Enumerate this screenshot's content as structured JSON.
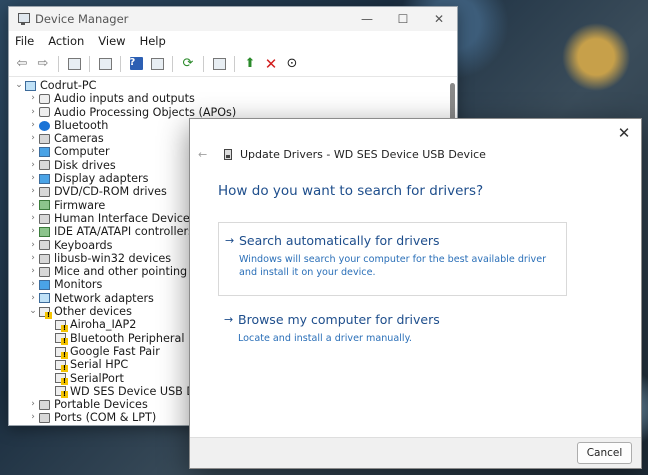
{
  "device_manager": {
    "title": "Device Manager",
    "window_controls": {
      "minimize": "—",
      "maximize": "☐",
      "close": "✕"
    },
    "menu": [
      "File",
      "Action",
      "View",
      "Help"
    ],
    "tree_root": "Codrut-PC",
    "categories": [
      {
        "label": "Audio inputs and outputs",
        "icon": "speaker-icon"
      },
      {
        "label": "Audio Processing Objects (APOs)",
        "icon": "speaker-icon"
      },
      {
        "label": "Bluetooth",
        "icon": "bluetooth-icon"
      },
      {
        "label": "Cameras",
        "icon": "camera-icon"
      },
      {
        "label": "Computer",
        "icon": "computer-icon"
      },
      {
        "label": "Disk drives",
        "icon": "disk-icon"
      },
      {
        "label": "Display adapters",
        "icon": "display-adapter-icon"
      },
      {
        "label": "DVD/CD-ROM drives",
        "icon": "dvd-icon"
      },
      {
        "label": "Firmware",
        "icon": "firmware-icon"
      },
      {
        "label": "Human Interface Devices",
        "icon": "hid-icon"
      },
      {
        "label": "IDE ATA/ATAPI controllers",
        "icon": "ide-icon"
      },
      {
        "label": "Keyboards",
        "icon": "keyboard-icon"
      },
      {
        "label": "libusb-win32 devices",
        "icon": "usb-icon"
      },
      {
        "label": "Mice and other pointing devices",
        "icon": "mouse-icon"
      },
      {
        "label": "Monitors",
        "icon": "monitor-icon"
      },
      {
        "label": "Network adapters",
        "icon": "network-icon"
      }
    ],
    "other_devices": {
      "label": "Other devices",
      "children": [
        "Airoha_IAP2",
        "Bluetooth Peripheral Device",
        "Google Fast Pair",
        "Serial HPC",
        "SerialPort",
        "WD SES Device USB Device"
      ]
    },
    "after_categories": [
      {
        "label": "Portable Devices",
        "icon": "portable-icon"
      },
      {
        "label": "Ports (COM & LPT)",
        "icon": "port-icon"
      }
    ]
  },
  "update_drivers": {
    "title": "Update Drivers - WD SES Device USB Device",
    "close": "✕",
    "back": "←",
    "question": "How do you want to search for drivers?",
    "option_auto": {
      "title": "Search automatically for drivers",
      "description": "Windows will search your computer for the best available driver and install it on your device."
    },
    "option_browse": {
      "title": "Browse my computer for drivers",
      "description": "Locate and install a driver manually."
    },
    "cancel": "Cancel"
  }
}
